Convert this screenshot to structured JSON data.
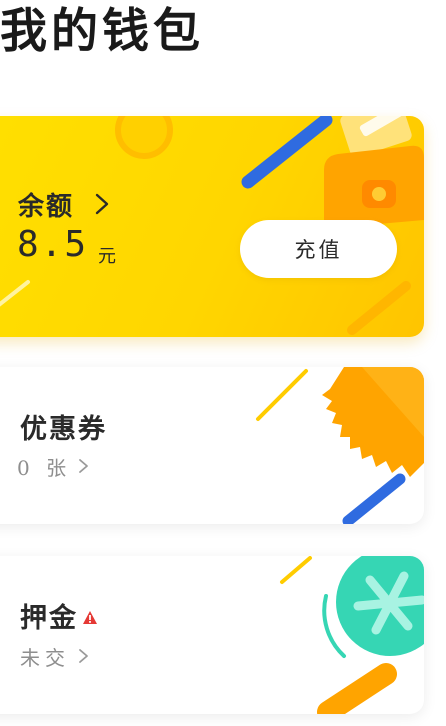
{
  "header": {
    "title": "我的钱包"
  },
  "balance_card": {
    "label": "余额",
    "amount": "8.5",
    "unit": "元",
    "recharge_label": "充值"
  },
  "coupon_card": {
    "label": "优惠券",
    "count_text": "0 张"
  },
  "deposit_card": {
    "label": "押金",
    "status_text": "未交"
  },
  "icons": {
    "balance": "wallet-icon",
    "coupon": "ticket-icon",
    "deposit": "snowflake-coin-icon",
    "warning": "warning-triangle-icon",
    "arrow": "chevron-right-icon"
  },
  "colors": {
    "balance_card": "#ffd600",
    "accent_orange": "#ffa400",
    "accent_blue": "#2f6be0",
    "accent_teal": "#36d6b4",
    "warning_red": "#e53935",
    "text_primary": "#2a2a2a",
    "text_secondary": "#8e8e8e"
  }
}
